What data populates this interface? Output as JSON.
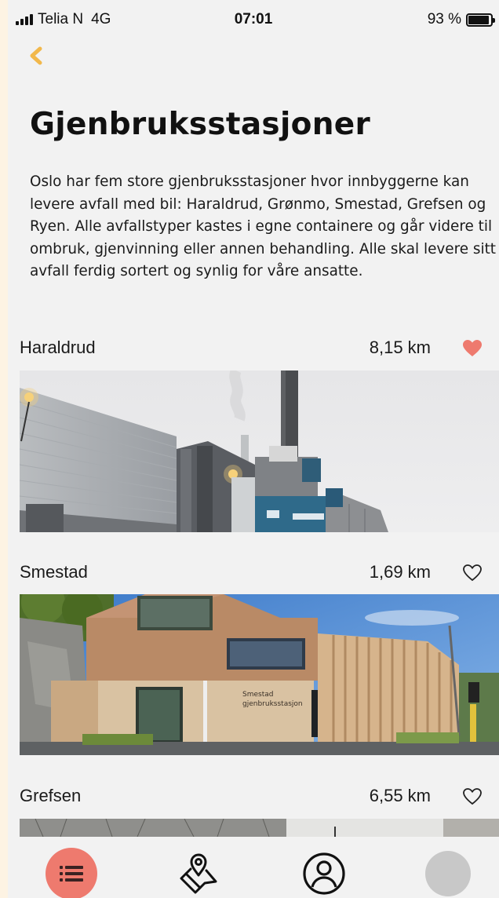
{
  "status": {
    "carrier": "Telia N",
    "network": "4G",
    "time": "07:01",
    "battery": "93 %",
    "battery_level": 0.93
  },
  "header": {
    "back_icon": "chevron-left-icon",
    "title": "Gjenbruksstasjoner"
  },
  "intro": "Oslo har fem store gjenbruksstasjoner hvor innbyggerne kan levere avfall med bil: Haraldrud, Grønmo, Smestad, Grefsen og Ryen. Alle avfallstyper kastes i egne containere og går videre til ombruk, gjenvinning eller annen behandling. Alle skal levere sitt avfall ferdig sortert og synlig for våre ansatte.",
  "stations": [
    {
      "name": "Haraldrud",
      "distance": "8,15 km",
      "favorite": true,
      "photo": "industrial-incinerator-building"
    },
    {
      "name": "Smestad",
      "distance": "1,69 km",
      "favorite": false,
      "photo": "smestad-recycling-station-building",
      "sign_text": "Smestad\ngjenbruksstasjon"
    },
    {
      "name": "Grefsen",
      "distance": "6,55 km",
      "favorite": false,
      "photo": "trees-and-sky"
    }
  ],
  "tabs": [
    {
      "name": "list",
      "icon": "list-icon",
      "active": true
    },
    {
      "name": "map",
      "icon": "map-pin-icon",
      "active": false
    },
    {
      "name": "profile",
      "icon": "user-circle-icon",
      "active": false
    },
    {
      "name": "avatar",
      "icon": "avatar-icon",
      "active": false
    }
  ],
  "colors": {
    "accent": "#ee7a6e",
    "back_chevron": "#f2b84b",
    "background": "#f2f2f2"
  }
}
